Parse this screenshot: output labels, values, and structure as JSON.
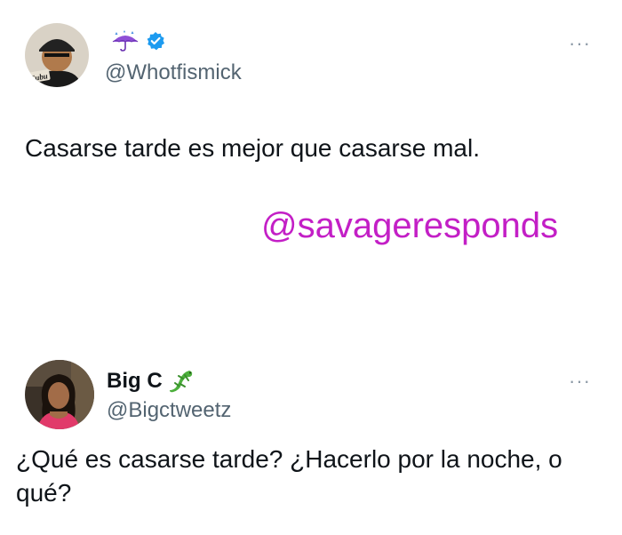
{
  "tweets": [
    {
      "display_name": "",
      "handle": "@Whotfismick",
      "text": "Casarse tarde es mejor que casarse mal.",
      "more": "···",
      "avatar_cap_text": "Fubu",
      "badges": [
        "umbrella-rain-icon",
        "verified-badge-icon"
      ]
    },
    {
      "display_name": "Big C",
      "handle": "@Bigctweetz",
      "text": "¿Qué es casarse tarde? ¿Hacerlo por la noche, o qué?",
      "more": "···",
      "badges": [
        "lizard-icon"
      ]
    }
  ],
  "watermark": "@savageresponds",
  "colors": {
    "watermark": "#c31fc6",
    "verified": "#1d9bf0",
    "handle": "#536471",
    "text": "#0f1419"
  }
}
